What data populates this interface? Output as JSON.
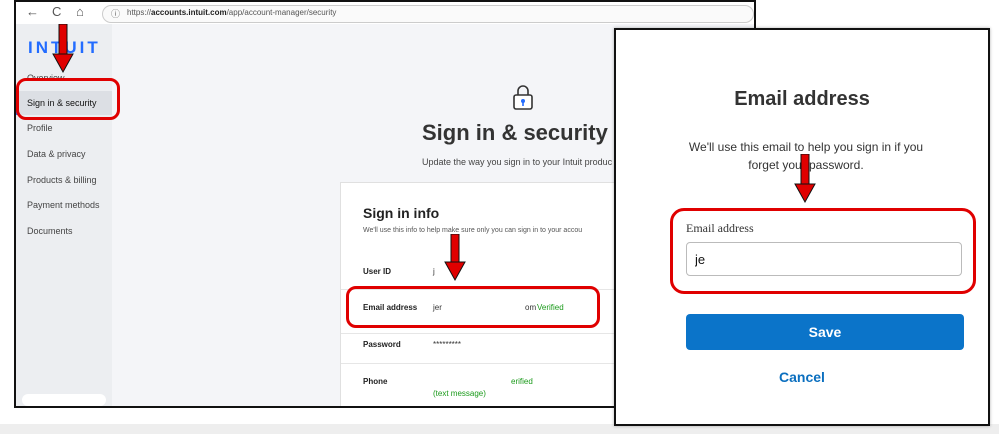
{
  "browser": {
    "url_prefix": "https://",
    "url_domain": "accounts.intuit.com",
    "url_path": "/app/account-manager/security",
    "back_icon": "←",
    "refresh_icon": "C",
    "home_icon": "⌂"
  },
  "sidebar": {
    "logo": "INTUIT",
    "items": [
      {
        "label": "Overview"
      },
      {
        "label": "Sign in & security"
      },
      {
        "label": "Profile"
      },
      {
        "label": "Data & privacy"
      },
      {
        "label": "Products & billing"
      },
      {
        "label": "Payment methods"
      },
      {
        "label": "Documents"
      }
    ]
  },
  "main": {
    "title": "Sign in & security",
    "subtitle": "Update the way you sign in to your Intuit produc"
  },
  "card": {
    "title": "Sign in info",
    "description": "We'll use this info to help make sure only you can sign in to your accou",
    "rows": [
      {
        "key": "User ID",
        "value": "j"
      },
      {
        "key": "Email address",
        "value": "jer",
        "suffix": "om",
        "status": "Verified"
      },
      {
        "key": "Password",
        "value": "*********"
      },
      {
        "key": "Phone",
        "status": "erified",
        "note": "(text message)"
      }
    ]
  },
  "dialog": {
    "title": "Email address",
    "description": "We'll use this email to help you sign in if you forget your password.",
    "field_label": "Email address",
    "field_value": "je",
    "save_label": "Save",
    "cancel_label": "Cancel"
  },
  "colors": {
    "brand_blue": "#236cff",
    "highlight_red": "#e00000",
    "save_button": "#0b74c9",
    "verified_green": "#1a9a1a"
  }
}
